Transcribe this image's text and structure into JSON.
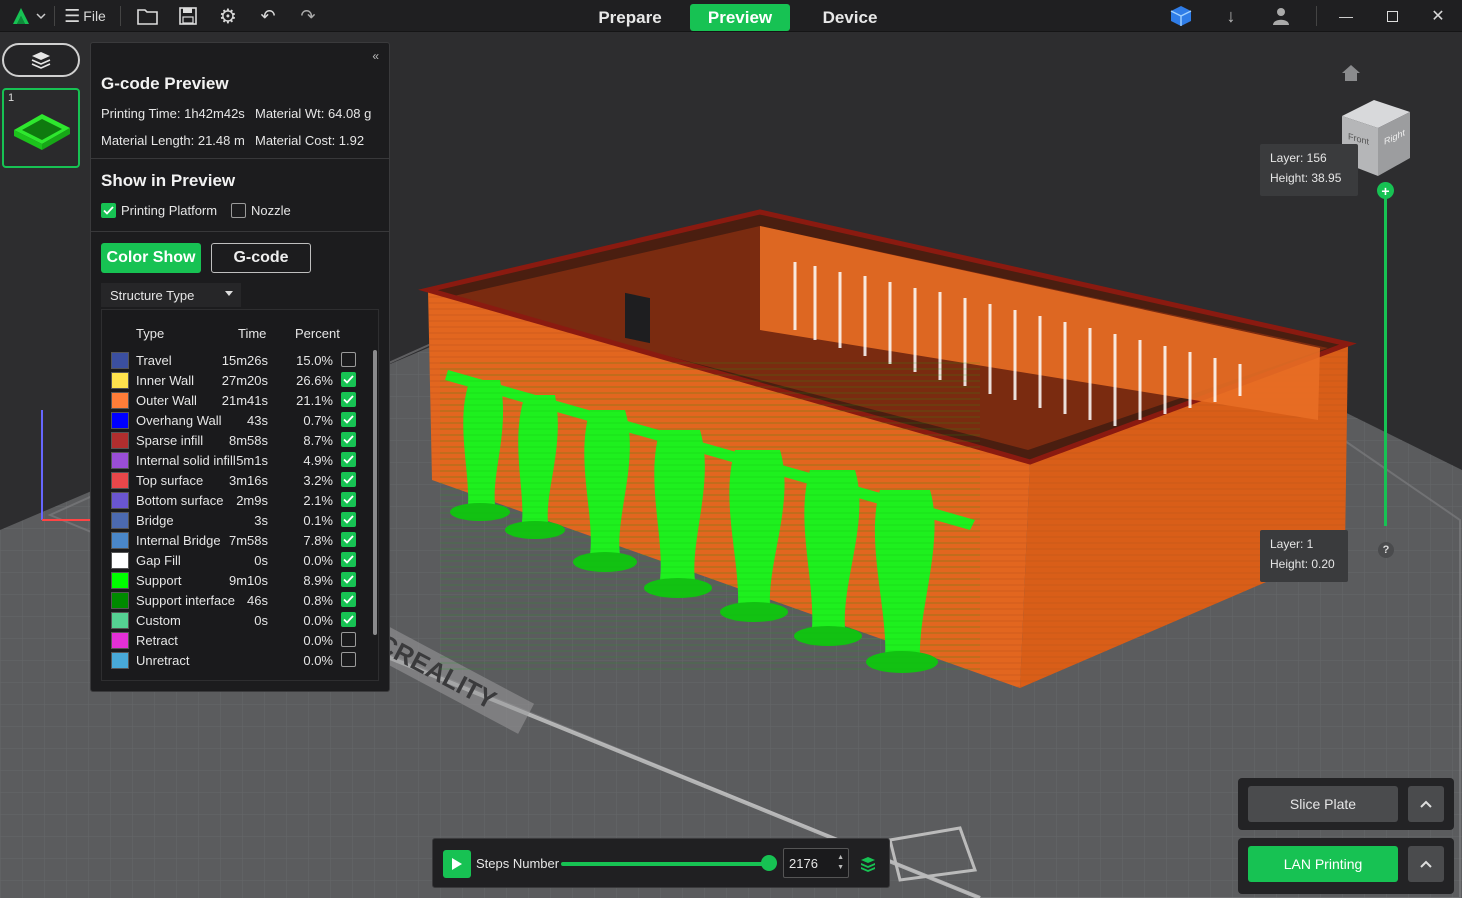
{
  "topbar": {
    "file_label": "File",
    "modes": [
      {
        "label": "Prepare"
      },
      {
        "label": "Preview"
      },
      {
        "label": "Device"
      }
    ],
    "active_mode": "Preview"
  },
  "plates": [
    {
      "number": "1"
    }
  ],
  "gcode_panel": {
    "title": "G-code Preview",
    "printing_time": "Printing Time: 1h42m42s",
    "material_wt": "Material Wt: 64.08 g",
    "material_length": "Material Length: 21.48 m",
    "material_cost": "Material Cost: 1.92",
    "show_title": "Show in Preview",
    "printing_platform": {
      "label": "Printing Platform",
      "checked": true
    },
    "nozzle": {
      "label": "Nozzle",
      "checked": false
    },
    "color_show_label": "Color Show",
    "gcode_label": "G-code",
    "structure_select": "Structure Type",
    "columns": {
      "type": "Type",
      "time": "Time",
      "percent": "Percent"
    },
    "rows": [
      {
        "type": "Travel",
        "time": "15m26s",
        "percent": "15.0%",
        "color": "#3b4fa0",
        "checked": false
      },
      {
        "type": "Inner Wall",
        "time": "27m20s",
        "percent": "26.6%",
        "color": "#ffe34d",
        "checked": true
      },
      {
        "type": "Outer Wall",
        "time": "21m41s",
        "percent": "21.1%",
        "color": "#ff7d38",
        "checked": true
      },
      {
        "type": "Overhang Wall",
        "time": "43s",
        "percent": "0.7%",
        "color": "#0000ff",
        "checked": true
      },
      {
        "type": "Sparse infill",
        "time": "8m58s",
        "percent": "8.7%",
        "color": "#b02e2e",
        "checked": true
      },
      {
        "type": "Internal solid infill",
        "time": "5m1s",
        "percent": "4.9%",
        "color": "#9a4ed6",
        "checked": true
      },
      {
        "type": "Top surface",
        "time": "3m16s",
        "percent": "3.2%",
        "color": "#e8474a",
        "checked": true
      },
      {
        "type": "Bottom surface",
        "time": "2m9s",
        "percent": "2.1%",
        "color": "#6a56d0",
        "checked": true
      },
      {
        "type": "Bridge",
        "time": "3s",
        "percent": "0.1%",
        "color": "#4c6ab0",
        "checked": true
      },
      {
        "type": "Internal Bridge",
        "time": "7m58s",
        "percent": "7.8%",
        "color": "#4a87c9",
        "checked": true
      },
      {
        "type": "Gap Fill",
        "time": "0s",
        "percent": "0.0%",
        "color": "#ffffff",
        "checked": true
      },
      {
        "type": "Support",
        "time": "9m10s",
        "percent": "8.9%",
        "color": "#00ff00",
        "checked": true
      },
      {
        "type": "Support interface",
        "time": "46s",
        "percent": "0.8%",
        "color": "#008a00",
        "checked": true
      },
      {
        "type": "Custom",
        "time": "0s",
        "percent": "0.0%",
        "color": "#55d192",
        "checked": true
      },
      {
        "type": "Retract",
        "time": "",
        "percent": "0.0%",
        "color": "#e22fd6",
        "checked": false
      },
      {
        "type": "Unretract",
        "time": "",
        "percent": "0.0%",
        "color": "#48a9d8",
        "checked": false
      }
    ]
  },
  "layer_slider": {
    "top_layer": "Layer: 156",
    "top_height": "Height: 38.95",
    "bottom_layer": "Layer: 1",
    "bottom_height": "Height: 0.20",
    "help": "?"
  },
  "view_cube": {
    "front": "Front",
    "right": "Right"
  },
  "bed_text": {
    "brand": "CREALITY"
  },
  "step_bar": {
    "label": "Steps Number",
    "value": "2176",
    "progress": 1.0
  },
  "actions": {
    "slice_plate": "Slice Plate",
    "lan_printing": "LAN Printing"
  },
  "colors": {
    "accent": "#17c253",
    "model": "#e2661f",
    "support": "#1ef01e"
  }
}
